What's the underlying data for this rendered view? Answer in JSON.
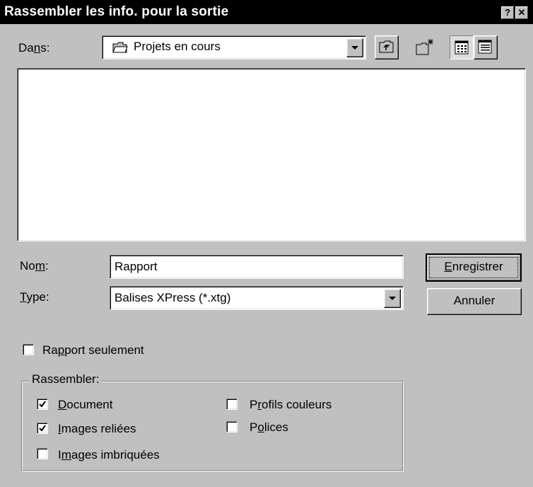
{
  "window": {
    "title": "Rassembler les info. pour la sortie",
    "help_btn": "?",
    "close_btn": "✕"
  },
  "location": {
    "label_pre": "Da",
    "label_u": "n",
    "label_post": "s:",
    "value": "Projets en cours"
  },
  "toolbar": {
    "up_folder": "up-one-level-icon",
    "new_folder": "new-folder-icon",
    "list_view": "list-view-icon",
    "details_view": "details-view-icon"
  },
  "name_field": {
    "label_pre": "No",
    "label_u": "m",
    "label_post": ":",
    "value": "Rapport"
  },
  "type_field": {
    "label_u": "T",
    "label_post": "ype:",
    "value": "Balises XPress (*.xtg)"
  },
  "buttons": {
    "save_u": "E",
    "save_post": "nregistrer",
    "cancel": "Annuler"
  },
  "report_only": {
    "label_pre": "Ra",
    "label_u": "p",
    "label_post": "port seulement",
    "checked": false
  },
  "collect": {
    "legend": "Rassembler:",
    "document": {
      "u": "D",
      "post": "ocument",
      "checked": true
    },
    "linked_images": {
      "u": "I",
      "post": "mages reliées",
      "checked": true
    },
    "embedded_images": {
      "pre": "I",
      "u": "m",
      "post": "ages imbriquées",
      "checked": false
    },
    "color_profiles": {
      "pre": "P",
      "u": "r",
      "post": "ofils couleurs",
      "checked": false
    },
    "fonts": {
      "pre": "P",
      "u": "o",
      "post": "lices",
      "checked": false
    }
  }
}
